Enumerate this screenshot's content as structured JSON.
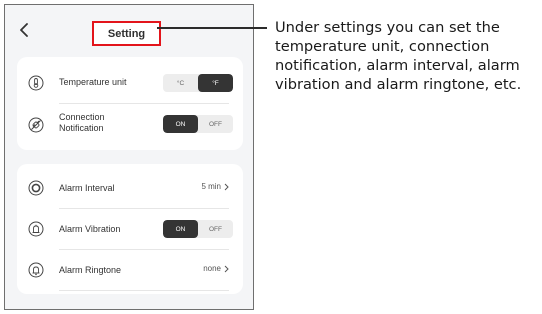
{
  "header": {
    "title": "Setting"
  },
  "settings_group_1": {
    "temperature_unit": {
      "label": "Temperature unit",
      "options": [
        "°C",
        "°F"
      ],
      "selected": "°F"
    },
    "connection_notification": {
      "label_line1": "Connection",
      "label_line2": "Notification",
      "options": [
        "ON",
        "OFF"
      ],
      "selected": "ON"
    }
  },
  "settings_group_2": {
    "alarm_interval": {
      "label": "Alarm Interval",
      "value": "5 min"
    },
    "alarm_vibration": {
      "label": "Alarm Vibration",
      "options": [
        "ON",
        "OFF"
      ],
      "selected": "ON"
    },
    "alarm_ringtone": {
      "label": "Alarm Ringtone",
      "value": "none"
    }
  },
  "annotation": {
    "text": "Under settings you can set the temperature unit, connection notification, alarm interval, alarm vibration and alarm ringtone, etc."
  },
  "colors": {
    "highlight_border": "#e3141b",
    "toggle_selected": "#343434"
  }
}
